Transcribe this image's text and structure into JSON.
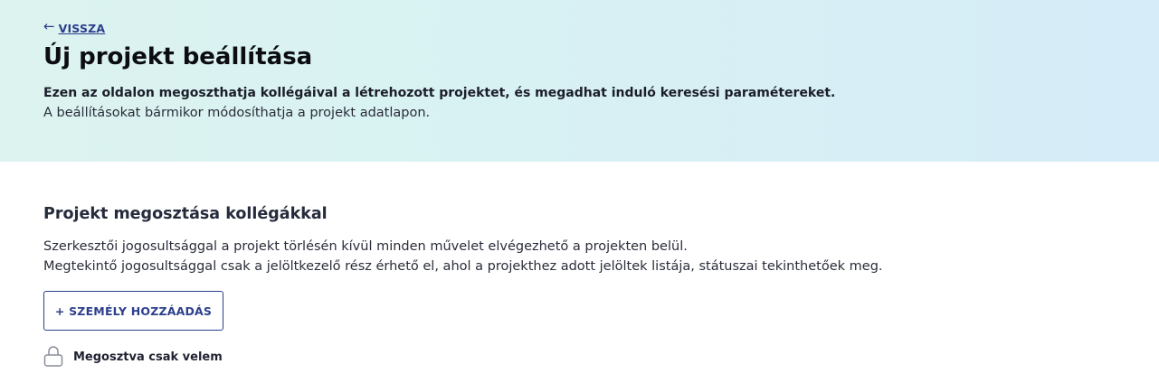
{
  "header": {
    "back_arrow": "←",
    "back_label": "VISSZA",
    "title": "Új projekt beállítása",
    "intro_bold": "Ezen az oldalon megoszthatja kollégáival a létrehozott projektet, és megadhat induló keresési paramétereket.",
    "intro_text": "A beállításokat bármikor módosíthatja a projekt adatlapon."
  },
  "sharing": {
    "title": "Projekt megosztása kollégákkal",
    "description_line1": "Szerkesztői jogosultsággal a projekt törlésén kívül minden művelet elvégezhető a projekten belül.",
    "description_line2": "Megtekintő jogosultsággal csak a jelöltkezelő rész érhető el, ahol a projekthez adott jelöltek listája, státuszai tekinthetőek meg.",
    "add_person_button": "+ SZEMÉLY HOZZÁADÁS",
    "shared_status_icon": "lock-icon",
    "shared_status": "Megosztva csak velem"
  },
  "colors": {
    "accent": "#2c3f8c",
    "header_gradient_start": "#dcf3ef",
    "header_gradient_end": "#d6ecf8"
  }
}
